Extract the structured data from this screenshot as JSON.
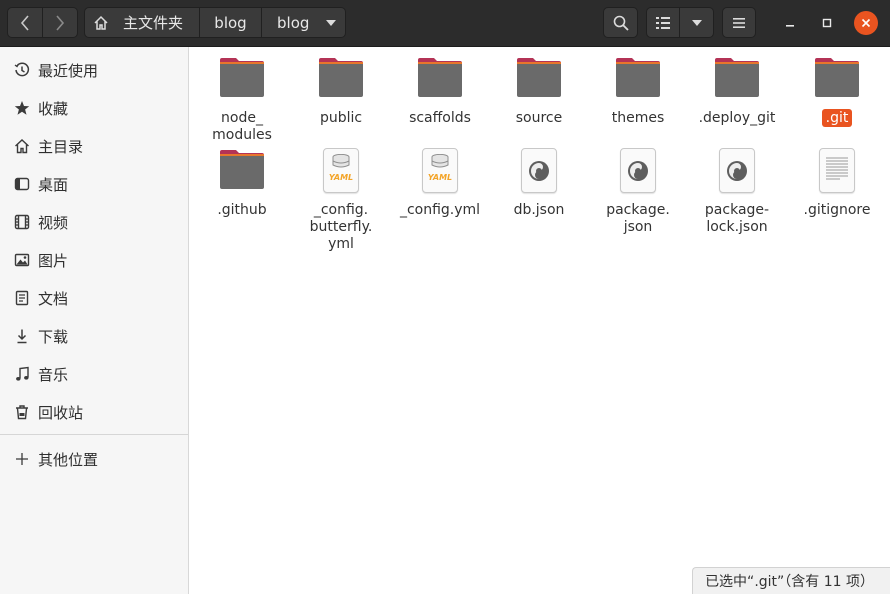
{
  "header": {
    "back_icon": "chevron-left-icon",
    "forward_icon": "chevron-right-icon",
    "breadcrumbs": [
      {
        "label": "主文件夹",
        "icon": "home-icon"
      },
      {
        "label": "blog"
      },
      {
        "label": "blog"
      }
    ],
    "search_icon": "search-icon",
    "view_list_icon": "list-view-icon",
    "view_options_icon": "chevron-down-icon",
    "menu_icon": "hamburger-menu-icon",
    "close_color": "#e95420"
  },
  "sidebar": {
    "items": [
      {
        "label": "最近使用",
        "icon": "clock-icon"
      },
      {
        "label": "收藏",
        "icon": "star-icon"
      },
      {
        "label": "主目录",
        "icon": "home-icon"
      },
      {
        "label": "桌面",
        "icon": "desktop-icon"
      },
      {
        "label": "视频",
        "icon": "film-icon"
      },
      {
        "label": "图片",
        "icon": "image-icon"
      },
      {
        "label": "文档",
        "icon": "document-icon"
      },
      {
        "label": "下载",
        "icon": "download-icon"
      },
      {
        "label": "音乐",
        "icon": "music-note-icon"
      },
      {
        "label": "回收站",
        "icon": "trash-icon"
      }
    ],
    "other_places": {
      "label": "其他位置",
      "icon": "plus-icon"
    }
  },
  "files": [
    {
      "name": "node_\nmodules",
      "type": "folder"
    },
    {
      "name": "public",
      "type": "folder"
    },
    {
      "name": "scaffolds",
      "type": "folder"
    },
    {
      "name": "source",
      "type": "folder"
    },
    {
      "name": "themes",
      "type": "folder"
    },
    {
      "name": ".deploy_git",
      "type": "folder"
    },
    {
      "name": ".git",
      "type": "folder",
      "selected": true
    },
    {
      "name": ".github",
      "type": "folder"
    },
    {
      "name": "_config.\nbutterfly.\nyml",
      "type": "yaml"
    },
    {
      "name": "_config.yml",
      "type": "yaml"
    },
    {
      "name": "db.json",
      "type": "json"
    },
    {
      "name": "package.\njson",
      "type": "json"
    },
    {
      "name": "package-\nlock.json",
      "type": "json"
    },
    {
      "name": ".gitignore",
      "type": "text"
    }
  ],
  "yaml_badge": "YAML",
  "status": {
    "text": "已选中“.git”（含有 11 项）"
  },
  "colors": {
    "accent": "#e95420",
    "folder_top": "#b43356",
    "folder_body": "#6a6a6a",
    "yaml": "#f3a428"
  }
}
